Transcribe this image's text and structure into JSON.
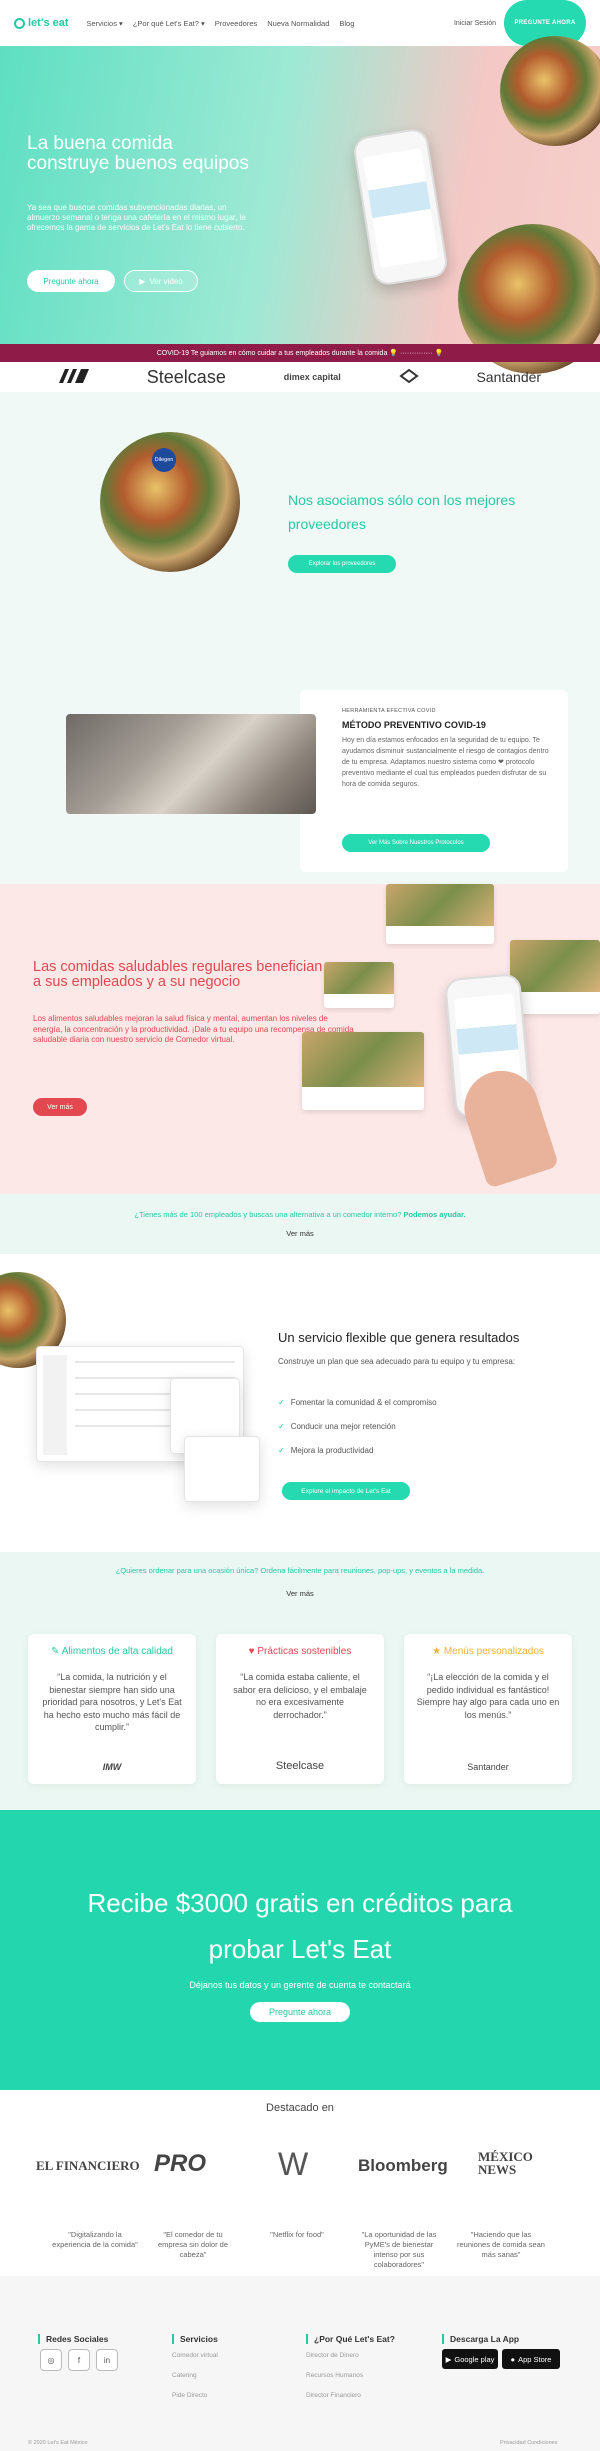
{
  "nav": {
    "logo": "let's eat",
    "links": [
      "Servicios ▾",
      "¿Por qué Let's Eat? ▾",
      "Proveedores",
      "Nueva Normalidad",
      "Blog"
    ],
    "signin": "Iniciar Sesión",
    "cta": "PREGUNTE AHORA"
  },
  "hero": {
    "title": "La buena comida construye buenos equipos",
    "subtitle": "Ya sea que busque comidas subvencionadas diarias, un almuerzo semanal o tenga una cafetería en el mismo lugar, le ofrecemos la gama de servicios de Let's Eat lo tiene cubierto.",
    "ask": "Pregunte ahora",
    "video": "Ver video",
    "play_icon": "▶"
  },
  "covid_bar": "COVID-19 Te guiamos en cómo cuidar a tus empleados durante la comida 💡 ·············· 💡",
  "clients": [
    "Steelcase",
    "dimex capital",
    "Santander"
  ],
  "partners": {
    "title": "Nos asociamos sólo con los mejores proveedores",
    "button": "Explorar los proveedores",
    "tag": "Dilegen"
  },
  "covid_method": {
    "kicker": "HERRAMIENTA EFECTIVA COVID",
    "title": "MÉTODO PREVENTIVO COVID-19",
    "body": "Hoy en día estamos enfocados en la seguridad de tu equipo. Te ayudamos disminuir sustancialmente el riesgo de contagios dentro de tu empresa. Adaptamos nuestro sistema como ❤ protocolo preventivo mediante el cual tus empleados pueden disfrutar de su hora de comida seguros.",
    "button": "Ver Más Sobre Nuestros Protocolos"
  },
  "healthy": {
    "title": "Las comidas saludables regulares benefician a sus empleados y a su negocio",
    "body": "Los alimentos saludables mejoran la salud física y mental, aumentan los niveles de energía, la concentración y la productividad. ¡Dale a tu equipo una recompensa de comida saludable diaria con nuestro servicio de Comedor virtual.",
    "button": "Ver más"
  },
  "band1": {
    "text": "¿Tienes más de 100 empleados y buscas una alternativa a un comedor interno?",
    "strong": "Podemos ayudar.",
    "more": "Ver más"
  },
  "flexible": {
    "title": "Un servicio flexible que genera resultados",
    "body": "Construye un plan que sea adecuado para tu equipo y tu empresa:",
    "items": [
      "Fomentar la comunidad & el compromiso",
      "Conducir una mejor retención",
      "Mejora la productividad"
    ],
    "button": "Explore el impacto de Let's Eat"
  },
  "band2": {
    "text": "¿Quieres ordenar para una ocasión única? Ordena fácilmente para reuniones, pop-ups, y eventos a la medida.",
    "more": "Ver más"
  },
  "testimonials": [
    {
      "title": "Alimentos de alta calidad",
      "color": "#25c9a3",
      "icon": "leaf-icon",
      "glyph": "✎",
      "quote": "“La comida, la nutrición y el bienestar siempre han sido una prioridad para nosotros, y Let's Eat ha hecho esto mucho más fácil de cumplir.”",
      "logo": "IMW"
    },
    {
      "title": "Prácticas sostenibles",
      "color": "#e3474f",
      "icon": "heart-icon",
      "glyph": "♥",
      "quote": "“La comida estaba caliente, el sabor era delicioso, y el embalaje no era excesivamente derrochador.”",
      "logo": "Steelcase"
    },
    {
      "title": "Menús personalizados",
      "color": "#f2b233",
      "icon": "star-icon",
      "glyph": "★",
      "quote": "“¡La elección de la comida y el pedido individual es fantástico! Siempre hay algo para cada uno en los menús.”",
      "logo": "Santander"
    }
  ],
  "credits": {
    "title": "Recibe $3000 gratis en créditos para probar Let's Eat",
    "sub": "Déjanos tus datos y un gerente de cuenta te contactará",
    "button": "Pregunte ahora"
  },
  "press": {
    "title": "Destacado en",
    "logos": [
      "EL FINANCIERO",
      "PRO",
      "W",
      "Bloomberg",
      "MÉXICO NEWS"
    ],
    "quotes": [
      "\"Digitalizando la experiencia de la comida\"",
      "\"El comedor de tu empresa sin dolor de cabeza\"",
      "\"Netflix for food\"",
      "\"La oportunidad de las PyME's de bienestar intenso por sus colaboradores\"",
      "\"Haciendo que las reuniones de comida sean más sanas\""
    ]
  },
  "footer": {
    "social_title": "Redes Sociales",
    "services_title": "Servicios",
    "services": [
      "Comedor virtual",
      "Catering",
      "Pide Directo"
    ],
    "why_title": "¿Por Qué Let's Eat?",
    "why": [
      "Director de Dinero",
      "Recursos Humanos",
      "Director Financiero"
    ],
    "app_title": "Descarga La App",
    "google": "Google play",
    "apple": "App Store",
    "copyright": "© 2020 Let's Eat México",
    "privacy": "Privacidad  Condiciones"
  }
}
